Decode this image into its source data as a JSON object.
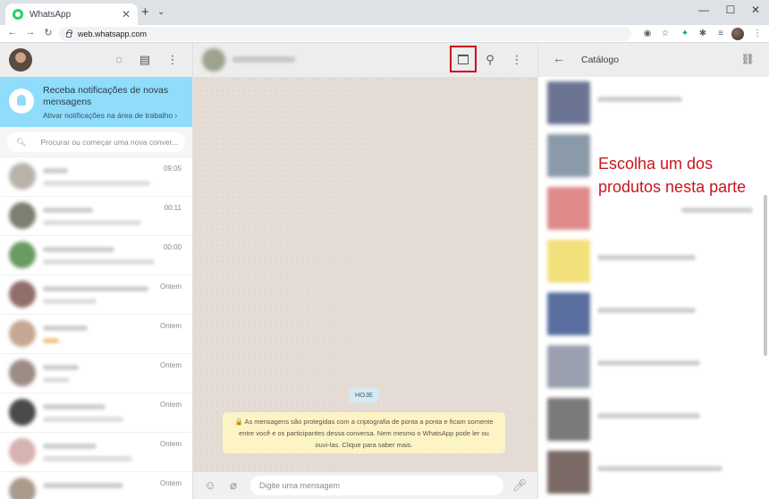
{
  "browser": {
    "tab_title": "WhatsApp",
    "url": "web.whatsapp.com"
  },
  "left": {
    "notification": {
      "title": "Receba notificações de novas mensagens",
      "link": "Ativar notificações na área de trabalho ›"
    },
    "search_placeholder": "Procurar ou começar uma nova conver...",
    "chats": [
      {
        "time": "09:05"
      },
      {
        "time": "00:11"
      },
      {
        "time": "00:00"
      },
      {
        "time": "Ontem"
      },
      {
        "time": "Ontem"
      },
      {
        "time": "Ontem"
      },
      {
        "time": "Ontem"
      },
      {
        "time": "Ontem"
      },
      {
        "time": "Ontem"
      }
    ]
  },
  "middle": {
    "day_label": "HOJE",
    "encryption_notice": "🔒 As mensagens são protegidas com a criptografia de ponta a ponta e ficam somente entre você e os participantes dessa conversa. Nem mesmo o WhatsApp pode ler ou ouvi-las. Clique para saber mais.",
    "compose_placeholder": "Digite uma mensagem"
  },
  "right": {
    "title": "Catálogo",
    "callout_line1": "Escolha um dos",
    "callout_line2": "produtos nesta parte"
  }
}
